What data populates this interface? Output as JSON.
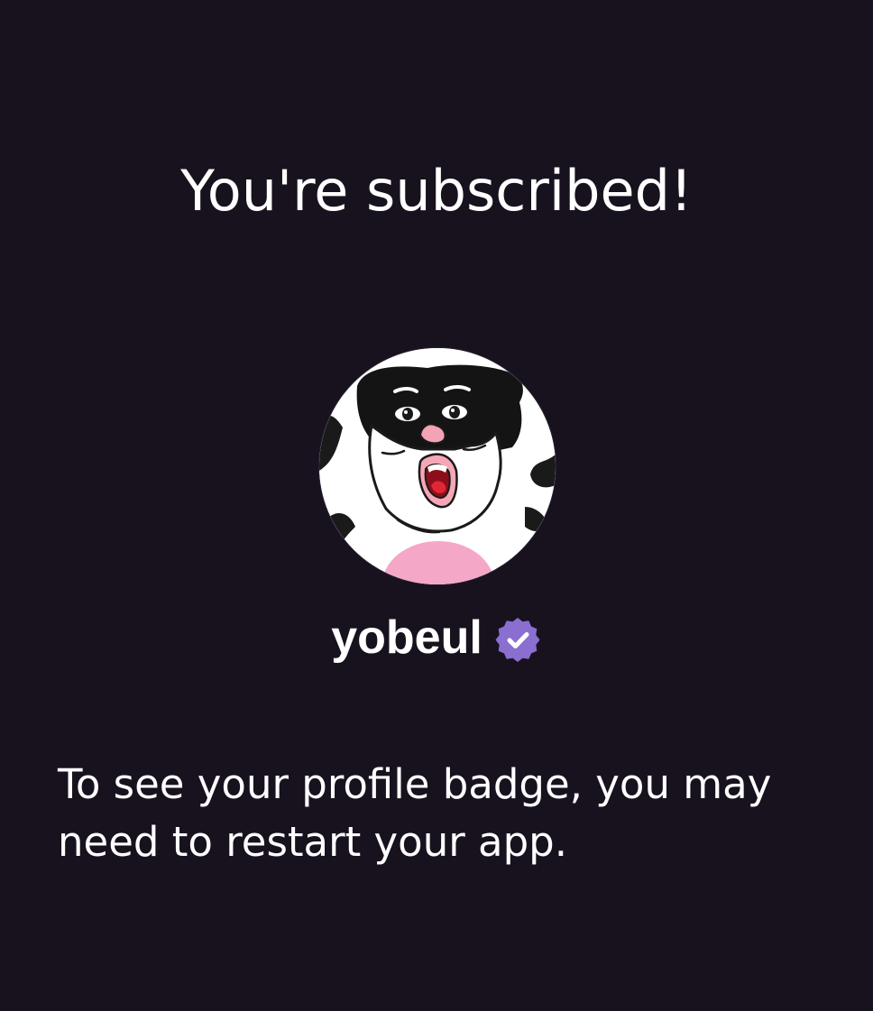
{
  "screen": {
    "title": "You're subscribed!",
    "message": "To see your profile badge, you may need to restart your app."
  },
  "profile": {
    "username": "yobeul",
    "avatar_icon": "cartoon-face-avatar",
    "verified": true,
    "verified_icon": "verified-badge-icon"
  },
  "colors": {
    "background": "#18121f",
    "text": "#ffffff",
    "badge": "#8a6fd1",
    "avatar_pink": "#f5a7c8"
  }
}
